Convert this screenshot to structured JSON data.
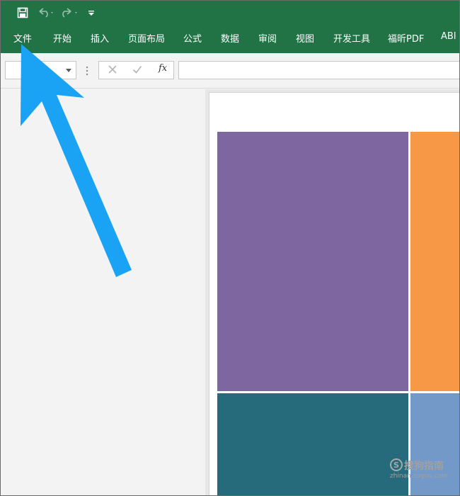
{
  "quick_access": {
    "save_icon": "save-icon",
    "undo_icon": "undo-icon",
    "redo_icon": "redo-icon",
    "customize_icon": "customize-qat-icon"
  },
  "ribbon": {
    "tabs": [
      "文件",
      "开始",
      "插入",
      "页面布局",
      "公式",
      "数据",
      "审阅",
      "视图",
      "开发工具",
      "福昕PDF",
      "ABI"
    ]
  },
  "formula_bar": {
    "name_box_value": "",
    "fx_label": "fx",
    "formula_value": "",
    "cancel_icon": "cancel-icon",
    "enter_icon": "check-icon"
  },
  "treemap": {
    "colors": [
      "#7e66a0",
      "#f79847",
      "#256b7b",
      "#7399c9"
    ]
  },
  "annotation": {
    "arrow_color": "#1aa3f5",
    "arrow_icon": "pointer-arrow-icon"
  },
  "watermark": {
    "main": "搜狗指南",
    "sub": "zhinan.sogou.com",
    "logo": "S"
  }
}
